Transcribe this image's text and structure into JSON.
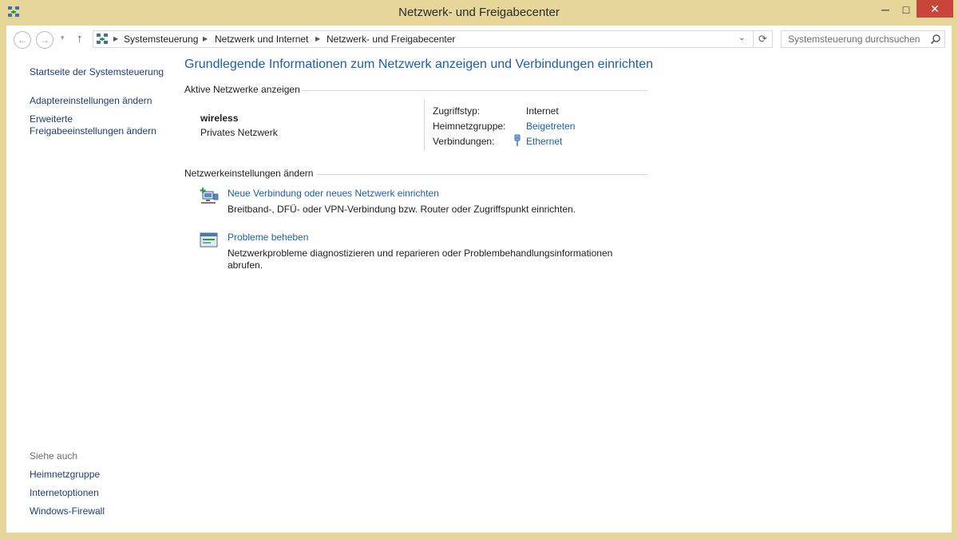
{
  "window": {
    "title": "Netzwerk- und Freigabecenter",
    "minimize_glyph": "─",
    "maximize_glyph": "□",
    "close_glyph": "✕"
  },
  "nav": {
    "back_glyph": "←",
    "forward_glyph": "→",
    "up_glyph": "↑",
    "history_glyph": "▾",
    "breadcrumb": [
      "Systemsteuerung",
      "Netzwerk und Internet",
      "Netzwerk- und Freigabecenter"
    ],
    "refresh_glyph": "⟳",
    "dropdown_glyph": "⌄",
    "search_placeholder": "Systemsteuerung durchsuchen"
  },
  "sidebar": {
    "home": "Startseite der Systemsteuerung",
    "links": [
      "Adaptereinstellungen ändern",
      "Erweiterte Freigabeeinstellungen ändern"
    ],
    "see_also_title": "Siehe auch",
    "see_also": [
      "Heimnetzgruppe",
      "Internetoptionen",
      "Windows-Firewall"
    ]
  },
  "main": {
    "title": "Grundlegende Informationen zum Netzwerk anzeigen und Verbindungen einrichten",
    "active_section": "Aktive Netzwerke anzeigen",
    "network": {
      "name": "wireless",
      "type": "Privates Netzwerk",
      "access_label": "Zugriffstyp:",
      "access_value": "Internet",
      "homegroup_label": "Heimnetzgruppe:",
      "homegroup_value": "Beigetreten",
      "connections_label": "Verbindungen:",
      "connections_value": "Ethernet"
    },
    "settings_section": "Netzwerkeinstellungen ändern",
    "tasks": [
      {
        "link": "Neue Verbindung oder neues Netzwerk einrichten",
        "desc": "Breitband-, DFÜ- oder VPN-Verbindung bzw. Router oder Zugriffspunkt einrichten."
      },
      {
        "link": "Probleme beheben",
        "desc": "Netzwerkprobleme diagnostizieren und reparieren oder Problembehandlungsinformationen abrufen."
      }
    ]
  },
  "colors": {
    "frame": "#e6d69a",
    "link": "#1e5fa8",
    "sidebar_link": "#1e3d73",
    "close_button": "#c7453a"
  }
}
